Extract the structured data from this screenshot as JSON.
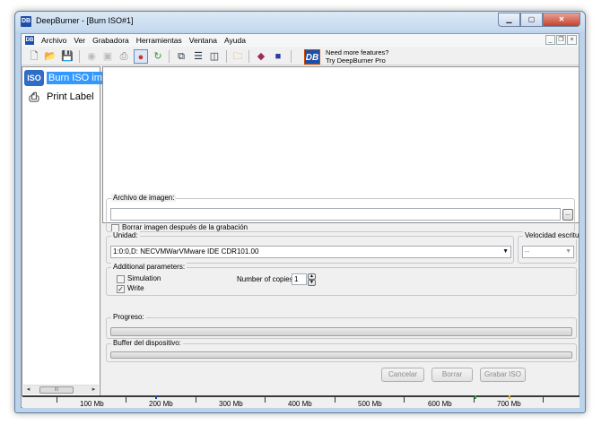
{
  "window": {
    "title": "DeepBurner - [Burn ISO#1]",
    "app_icon": "DB"
  },
  "menu": {
    "logo": "DB",
    "items": [
      "Archivo",
      "Ver",
      "Grabadora",
      "Herramientas",
      "Ventana",
      "Ayuda"
    ]
  },
  "toolbar": {
    "icons": [
      "new-icon",
      "open-icon",
      "save-icon",
      "erase-disc-icon",
      "copy-disc-icon",
      "print-icon",
      "burn-icon",
      "refresh-icon",
      "cascade-icon",
      "tile-horizontal-icon",
      "tile-vertical-icon",
      "folder-icon",
      "book-icon",
      "cube-icon"
    ],
    "promo_logo": "DB",
    "promo_line1": "Need more features?",
    "promo_line2": "Try DeepBurner Pro"
  },
  "sidebar": {
    "items": [
      {
        "label": "Burn ISO im",
        "icon": "iso-icon",
        "icon_text": "ISO"
      },
      {
        "label": "Print Label",
        "icon": "printer-icon",
        "icon_text": ""
      }
    ],
    "scroll_thumb": "III"
  },
  "image_file": {
    "group_label": "Archivo de imagen:",
    "path": "",
    "browse_label": "...",
    "delete_after_label": "Borrar imagen después de la grabación",
    "delete_after_checked": false
  },
  "drive": {
    "group_label": "Unidad:",
    "selected": "1:0:0,D: NECVMWarVMware IDE CDR101.00",
    "speed_label": "Velocidad escritura",
    "speed_value": "--"
  },
  "additional": {
    "group_label": "Additional parameters:",
    "simulation_label": "Simulation",
    "simulation_checked": false,
    "write_label": "Write",
    "write_checked": true,
    "copies_label": "Number of copies:",
    "copies_value": "1"
  },
  "progress": {
    "label": "Progreso:",
    "fraction": 0
  },
  "buffer": {
    "label": "Buffer del dispositivo:",
    "fraction": 0
  },
  "buttons": {
    "cancel": "Cancelar",
    "erase": "Borrar",
    "burn": "Grabar ISO"
  },
  "ruler": {
    "labels": [
      "100 Mb",
      "200 Mb",
      "300 Mb",
      "400 Mb",
      "500 Mb",
      "600 Mb",
      "700 Mb"
    ]
  },
  "colors": {
    "selection": "#3399ff",
    "title_bar": "#c4d8ee",
    "close_button": "#c3412c"
  }
}
